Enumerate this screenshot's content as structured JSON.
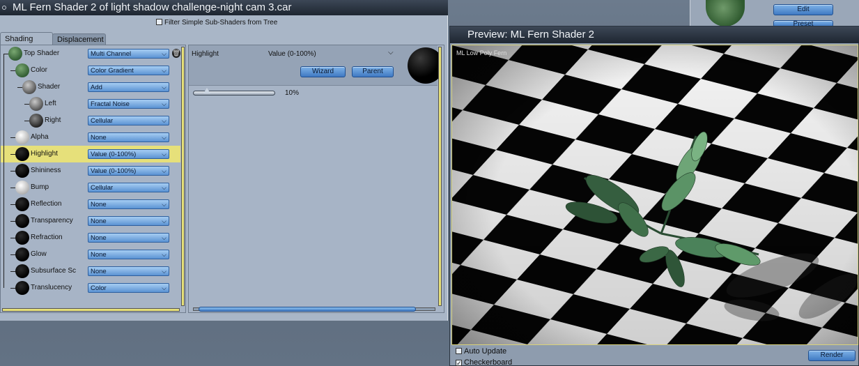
{
  "window": {
    "title": "ML Fern Shader 2 of light shadow challenge-night cam 3.car",
    "filter_label": "Filter Simple Sub-Shaders from Tree",
    "filter_checked": false
  },
  "tabs": [
    {
      "label": "Shading",
      "active": true
    },
    {
      "label": "Displacement",
      "active": false
    }
  ],
  "tree": [
    {
      "label": "Top Shader",
      "value": "Multi Channel",
      "ball": "green",
      "level": 0
    },
    {
      "label": "Color",
      "value": "Color Gradient",
      "ball": "green",
      "level": 1
    },
    {
      "label": "Shader",
      "value": "Add",
      "ball": "rock",
      "level": 2
    },
    {
      "label": "Left",
      "value": "Fractal Noise",
      "ball": "rock",
      "level": 3
    },
    {
      "label": "Right",
      "value": "Cellular",
      "ball": "dark-rock",
      "level": 3
    },
    {
      "label": "Alpha",
      "value": "None",
      "ball": "white",
      "level": 1
    },
    {
      "label": "Highlight",
      "value": "Value (0-100%)",
      "ball": "black",
      "level": 1,
      "selected": true
    },
    {
      "label": "Shininess",
      "value": "Value (0-100%)",
      "ball": "black",
      "level": 1
    },
    {
      "label": "Bump",
      "value": "Cellular",
      "ball": "white",
      "level": 1
    },
    {
      "label": "Reflection",
      "value": "None",
      "ball": "black",
      "level": 1
    },
    {
      "label": "Transparency",
      "value": "None",
      "ball": "black",
      "level": 1
    },
    {
      "label": "Refraction",
      "value": "None",
      "ball": "black",
      "level": 1
    },
    {
      "label": "Glow",
      "value": "None",
      "ball": "black",
      "level": 1
    },
    {
      "label": "Subsurface Sc",
      "value": "None",
      "ball": "black",
      "level": 1
    },
    {
      "label": "Translucency",
      "value": "Color",
      "ball": "black",
      "level": 1
    }
  ],
  "param": {
    "name": "Highlight",
    "type": "Value (0-100%)",
    "wizard_label": "Wizard",
    "parent_label": "Parent",
    "slider_value_text": "10%",
    "slider_fraction": 0.1
  },
  "background_panel": {
    "edit_label": "Edit",
    "preset_label": "Preset"
  },
  "preview": {
    "title": "Preview: ML Fern Shader 2",
    "overlay_text": "ML Low Poly Fern",
    "auto_update_label": "Auto Update",
    "auto_update_checked": false,
    "checkerboard_label": "Checkerboard",
    "checkerboard_checked": true,
    "render_label": "Render"
  },
  "colors": {
    "selected_row": "#e6e07a",
    "button_blue": "#3f79c2",
    "titlebar": "#1e2631"
  }
}
